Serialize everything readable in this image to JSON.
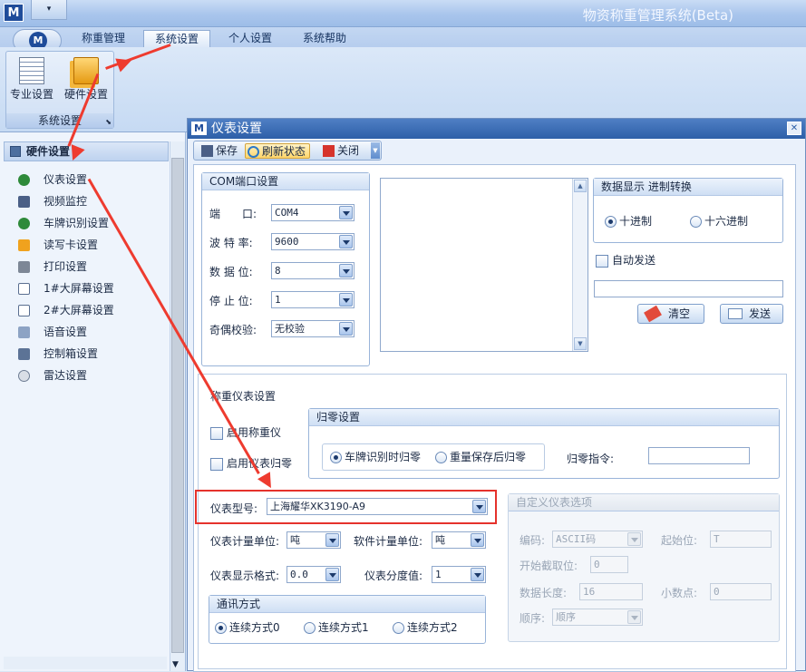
{
  "app": {
    "title": "物资称重管理系统(Beta)",
    "logo": "M",
    "qa": "▾"
  },
  "ribbon": {
    "tabs": [
      "称重管理",
      "系统设置",
      "个人设置",
      "系统帮助"
    ],
    "active_tab": "系统设置",
    "group_label": "系统设置",
    "buttons": [
      "专业设置",
      "硬件设置"
    ]
  },
  "sidebar": {
    "header": "硬件设置",
    "items": [
      {
        "label": "仪表设置",
        "icon": "gauge-icon"
      },
      {
        "label": "视频监控",
        "icon": "film-icon"
      },
      {
        "label": "车牌识别设置",
        "icon": "gauge-icon"
      },
      {
        "label": "读写卡设置",
        "icon": "card-icon"
      },
      {
        "label": "打印设置",
        "icon": "printer-icon"
      },
      {
        "label": "1#大屏幕设置",
        "icon": "document-icon"
      },
      {
        "label": "2#大屏幕设置",
        "icon": "document-icon"
      },
      {
        "label": "语音设置",
        "icon": "speaker-icon"
      },
      {
        "label": "控制箱设置",
        "icon": "control-box-icon"
      },
      {
        "label": "雷达设置",
        "icon": "radar-icon"
      }
    ]
  },
  "dialog": {
    "title": "仪表设置",
    "toolbar": {
      "save": "保存",
      "refresh": "刷新状态",
      "close": "关闭"
    },
    "com": {
      "title": "COM端口设置",
      "port_label": "端　　口:",
      "port": "COM4",
      "baud_label": "波 特 率:",
      "baud": "9600",
      "databits_label": "数 据 位:",
      "databits": "8",
      "stopbits_label": "停 止 位:",
      "stopbits": "1",
      "parity_label": "奇偶校验:",
      "parity": "无校验"
    },
    "display": {
      "title": "数据显示 进制转换",
      "decimal": "十进制",
      "hex": "十六进制",
      "auto_send": "自动发送",
      "clear": "清空",
      "send": "发送"
    },
    "scale": {
      "title": "称重仪表设置",
      "enable_scale": "启用称重仪",
      "enable_zero": "启用仪表归零",
      "zero_title": "归零设置",
      "zero_opt1": "车牌识别时归零",
      "zero_opt2": "重量保存后归零",
      "zero_cmd_label": "归零指令:",
      "model_label": "仪表型号:",
      "model": "上海耀华XK3190-A9",
      "unit_label": "仪表计量单位:",
      "unit": "吨",
      "soft_unit_label": "软件计量单位:",
      "soft_unit": "吨",
      "format_label": "仪表显示格式:",
      "format": "0.0",
      "division_label": "仪表分度值:",
      "division": "1",
      "comm_title": "通讯方式",
      "comm_opts": [
        "连续方式0",
        "连续方式1",
        "连续方式2"
      ]
    },
    "custom": {
      "title": "自定义仪表选项",
      "encoding_label": "编码:",
      "encoding": "ASCII码",
      "start_label": "起始位:",
      "start": "T",
      "take_label": "开始截取位:",
      "take": "0",
      "length_label": "数据长度:",
      "length": "16",
      "decimal_label": "小数点:",
      "decimal": "0",
      "order_label": "顺序:",
      "order": "顺序"
    }
  },
  "colors": {
    "annotation": "#ee3b2f",
    "title_bar": "#2d5fa8"
  }
}
